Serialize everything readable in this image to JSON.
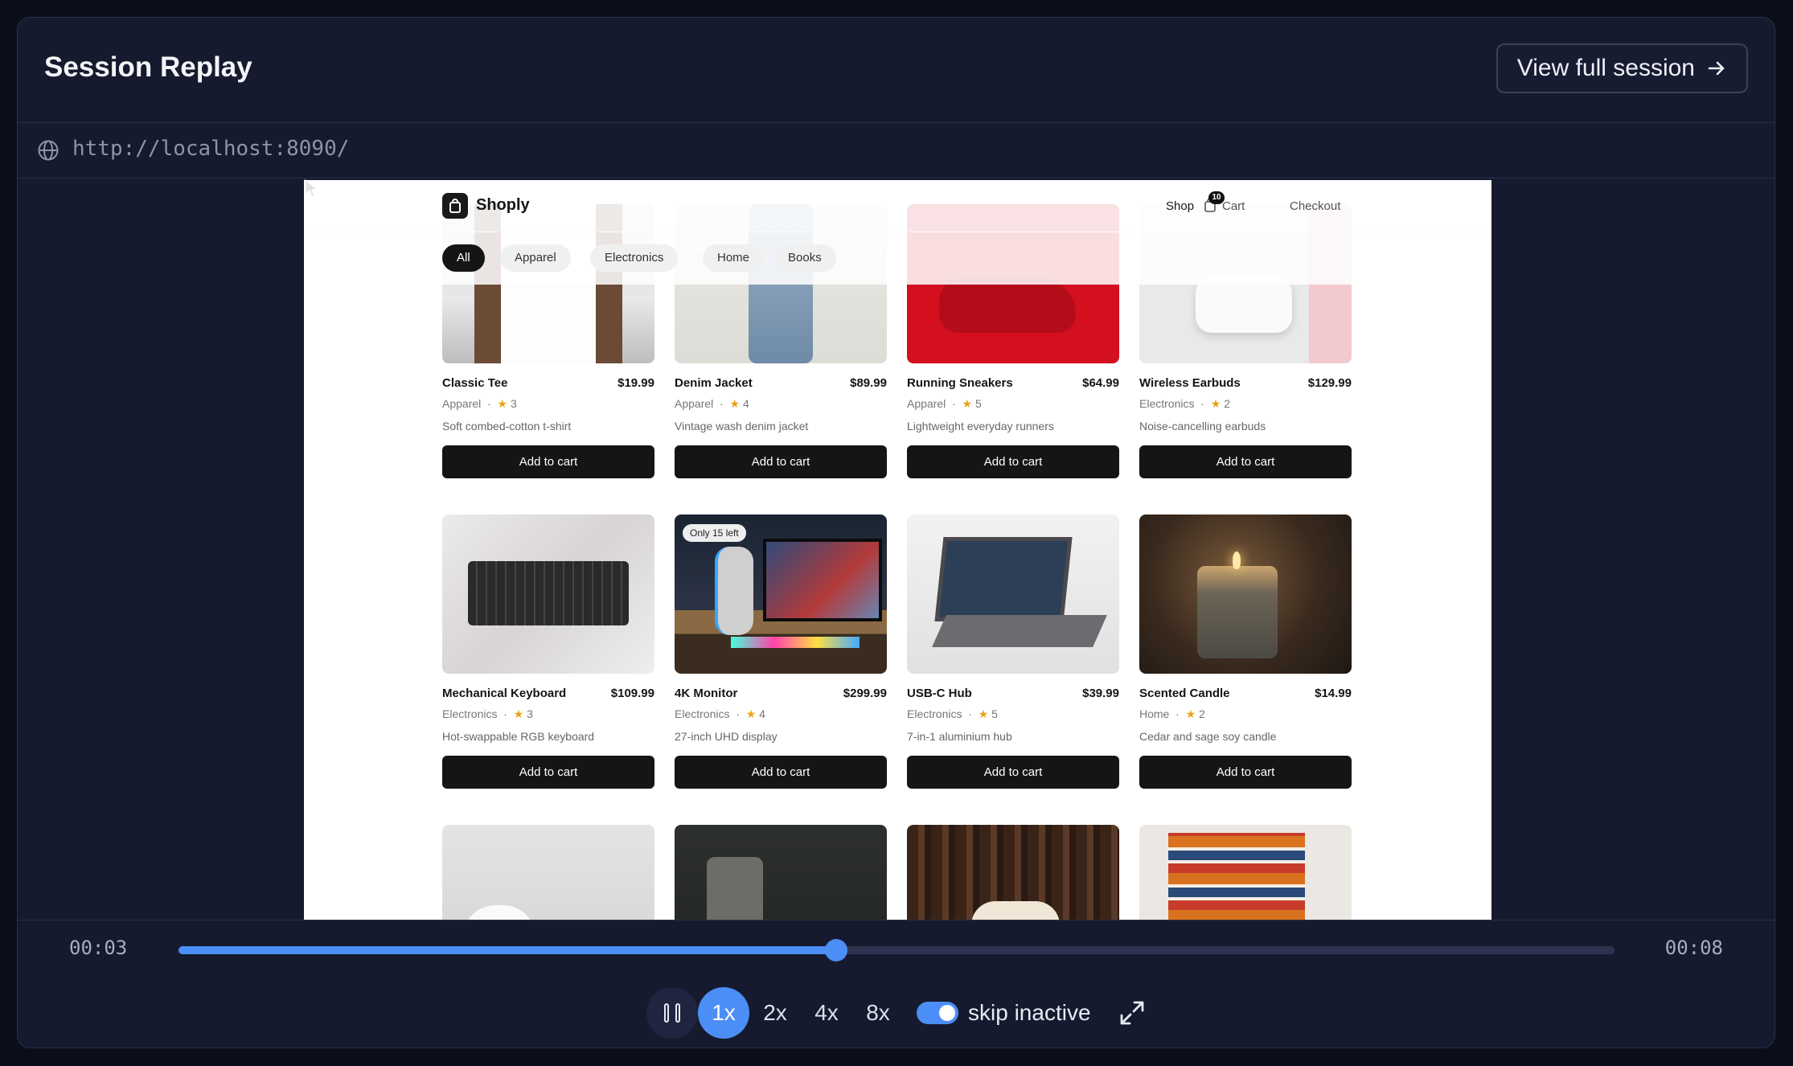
{
  "header": {
    "title": "Session Replay",
    "view_full_session": "View full session",
    "arrow_icon": "arrow-right-icon"
  },
  "urlbar": {
    "url": "http://localhost:8090/",
    "icon": "globe-icon"
  },
  "shop": {
    "logo": "Shoply",
    "nav": {
      "shop": "Shop",
      "cart": "Cart",
      "cart_count": "10",
      "checkout": "Checkout"
    },
    "filters": [
      "All",
      "Apparel",
      "Electronics",
      "Home",
      "Books"
    ],
    "active_filter": "All",
    "products": [
      {
        "name": "Classic Tee",
        "price": "$19.99",
        "category": "Apparel",
        "rating": "3",
        "desc": "Soft combed-cotton t-shirt",
        "button": "Add to cart"
      },
      {
        "name": "Denim Jacket",
        "price": "$89.99",
        "category": "Apparel",
        "rating": "4",
        "desc": "Vintage wash denim jacket",
        "button": "Add to cart"
      },
      {
        "name": "Running Sneakers",
        "price": "$64.99",
        "category": "Apparel",
        "rating": "5",
        "desc": "Lightweight everyday runners",
        "button": "Add to cart"
      },
      {
        "name": "Wireless Earbuds",
        "price": "$129.99",
        "category": "Electronics",
        "rating": "2",
        "desc": "Noise-cancelling earbuds",
        "button": "Add to cart"
      },
      {
        "name": "Mechanical Keyboard",
        "price": "$109.99",
        "category": "Electronics",
        "rating": "3",
        "desc": "Hot-swappable RGB keyboard",
        "button": "Add to cart"
      },
      {
        "name": "4K Monitor",
        "price": "$299.99",
        "category": "Electronics",
        "rating": "4",
        "desc": "27-inch UHD display",
        "button": "Add to cart",
        "badge": "Only 15 left"
      },
      {
        "name": "USB-C Hub",
        "price": "$39.99",
        "category": "Electronics",
        "rating": "5",
        "desc": "7-in-1 aluminium hub",
        "button": "Add to cart"
      },
      {
        "name": "Scented Candle",
        "price": "$14.99",
        "category": "Home",
        "rating": "2",
        "desc": "Cedar and sage soy candle",
        "button": "Add to cart"
      }
    ]
  },
  "player": {
    "current_time": "00:03",
    "total_time": "00:08",
    "progress": 0.458,
    "speeds": [
      "1x",
      "2x",
      "4x",
      "8x"
    ],
    "active_speed": "1x",
    "skip_inactive_label": "skip inactive",
    "skip_inactive_on": true,
    "accent": "#4b8ef5"
  }
}
